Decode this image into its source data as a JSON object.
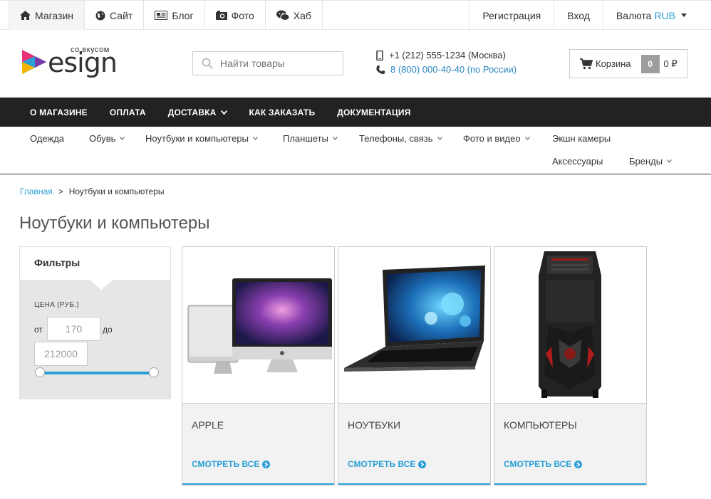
{
  "topbar": {
    "left": [
      {
        "label": "Магазин",
        "icon": "home-icon"
      },
      {
        "label": "Сайт",
        "icon": "globe-icon"
      },
      {
        "label": "Блог",
        "icon": "newspaper-icon"
      },
      {
        "label": "Фото",
        "icon": "camera-icon"
      },
      {
        "label": "Хаб",
        "icon": "wechat-icon"
      }
    ],
    "register": "Регистрация",
    "login": "Вход",
    "currency_label": "Валюта",
    "currency_value": "RUB"
  },
  "header": {
    "logo_tagline": "со вкусом",
    "logo_word": "esign",
    "search_placeholder": "Найти товары",
    "phone_main": "+1 (212) 555-1234 (Москва)",
    "phone_free": "8 (800) 000-40-40 (по России)",
    "cart_label": "Корзина",
    "cart_count": "0",
    "cart_sum": "0 ₽"
  },
  "darknav": {
    "items": [
      "О МАГАЗИНЕ",
      "ОПЛАТА",
      "ДОСТАВКА",
      "КАК ЗАКАЗАТЬ",
      "ДОКУМЕНТАЦИЯ"
    ]
  },
  "catnav": {
    "items": [
      "Одежда",
      "Обувь",
      "Ноутбуки и компьютеры",
      "Планшеты",
      "Телефоны, связь",
      "Фото и видео",
      "Экшн камеры",
      "Аксессуары",
      "Бренды"
    ]
  },
  "breadcrumb": {
    "home": "Главная",
    "sep": ">",
    "current": "Ноутбуки и компьютеры"
  },
  "page_title": "Ноутбуки и компьютеры",
  "filters": {
    "title": "Фильтры",
    "price_label": "ЦЕНА (РУБ.)",
    "from_label": "от",
    "to_label": "до",
    "min_value": "170",
    "max_value": "212000"
  },
  "cards": [
    {
      "title": "APPLE",
      "link": "СМОТРЕТЬ ВСЕ"
    },
    {
      "title": "НОУТБУКИ",
      "link": "СМОТРЕТЬ ВСЕ"
    },
    {
      "title": "КОМПЬЮТЕРЫ",
      "link": "СМОТРЕТЬ ВСЕ"
    }
  ],
  "colors": {
    "accent": "#2a9fd6",
    "darknav": "#222222"
  }
}
